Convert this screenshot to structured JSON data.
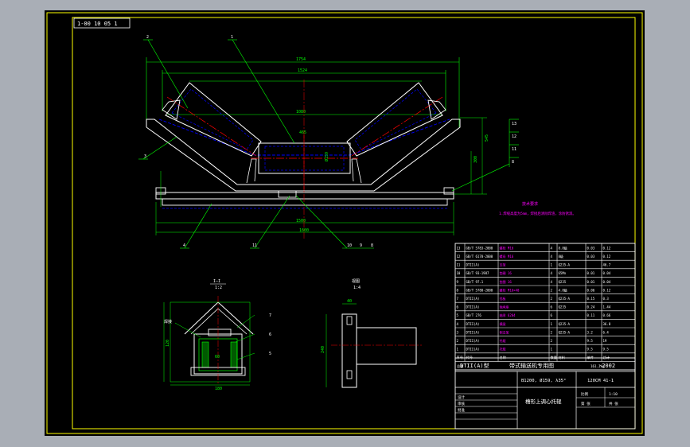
{
  "colors": {
    "background": "#a9aeb6",
    "sheet": "#000000",
    "outline": "#ffffff",
    "frame": "#ffff00",
    "dimension": "#00ff00",
    "hidden": "#0000ff",
    "center": "#ff0000",
    "note": "#ff00ff",
    "leader": "#00ff00"
  },
  "drawing_number_box": "1-00 10 05 1",
  "dimensions_main": {
    "overall_width": "1754",
    "top_width": "1524",
    "side_roll_angle": "35°",
    "inner_width": "1080",
    "center_roll": "465",
    "roll_height": "Ø159",
    "total_height": "545",
    "frame_height": "300",
    "bottom_span": "1600",
    "bolt_span": "1500"
  },
  "part_numbers": {
    "p1": "1",
    "p2": "2",
    "p3": "3",
    "p4": "4",
    "p8": "8",
    "p9": "9",
    "p10": "10",
    "p11": "11",
    "p12": "12",
    "p13": "13"
  },
  "section_views": {
    "section_a": "I—I",
    "section_a_scale": "1:2",
    "view_b": "视图",
    "view_b_scale": "1:4",
    "sec_dim_width": "180",
    "sec_dim_60": "60",
    "sec_dim_height": "120",
    "side_dim_top": "40",
    "side_dim_height": "240",
    "side_label_weld": "焊接",
    "sec_parts": [
      "7",
      "6",
      "5"
    ]
  },
  "tech_requirements": {
    "title": "技术要求",
    "line1": "1.焊缝高度为5mm，焊接后清除焊渣，涂防锈漆。"
  },
  "parts_table": {
    "rows": [
      [
        "13",
        "GB/T 5783-2000",
        "螺栓 M16",
        "4",
        "8.8级",
        "0.03",
        "0.12"
      ],
      [
        "12",
        "GB/T 6170-2000",
        "螺母 M16",
        "4",
        "8级",
        "0.03",
        "0.12"
      ],
      [
        "11",
        "DTII(A)",
        "支架",
        "1",
        "Q235-A",
        "",
        "46.7"
      ],
      [
        "10",
        "GB/T 93-1987",
        "垫圈 16",
        "4",
        "65Mn",
        "0.01",
        "0.04"
      ],
      [
        "9",
        "GB/T 97.1",
        "垫圈 16",
        "4",
        "Q235",
        "0.01",
        "0.04"
      ],
      [
        "8",
        "GB/T 5780-2000",
        "螺栓 M16×40",
        "2",
        "4.8级",
        "0.06",
        "0.12"
      ],
      [
        "7",
        "DTII(A)",
        "挡板",
        "2",
        "Q235-A",
        "0.15",
        "0.3"
      ],
      [
        "6",
        "DTII(A)",
        "轴承座",
        "6",
        "Q235",
        "0.24",
        "1.44"
      ],
      [
        "5",
        "GB/T 276",
        "轴承 6204",
        "6",
        "",
        "0.11",
        "0.66"
      ],
      [
        "4",
        "DTII(A)",
        "横梁",
        "1",
        "Q235-A",
        "",
        "36.8"
      ],
      [
        "3",
        "DTII(A)",
        "侧支架",
        "2",
        "Q235-A",
        "3.2",
        "6.4"
      ],
      [
        "2",
        "DTII(A)",
        "托辊",
        "2",
        "",
        "9.5",
        "19"
      ],
      [
        "1",
        "DTII(A)",
        "托辊",
        "1",
        "",
        "9.5",
        "9.5"
      ]
    ],
    "header": [
      "序号",
      "代号",
      "名称",
      "数量",
      "材料",
      "单件",
      "总计"
    ],
    "total_label": "总重",
    "total_value": "161.2kg"
  },
  "title_block": {
    "series": "DTII(A)型",
    "title": "带式输送机专用图",
    "year": "-2002",
    "spec": "B1200, Ø159, λ35°",
    "code": "120CM 41-1",
    "name": "槽形上调心托辊",
    "scale_label": "比例",
    "scale": "1:10",
    "sheet_label": "第 张",
    "sheets_label": "共 张",
    "designer": "设计",
    "checker": "审核",
    "approver": "批准"
  }
}
